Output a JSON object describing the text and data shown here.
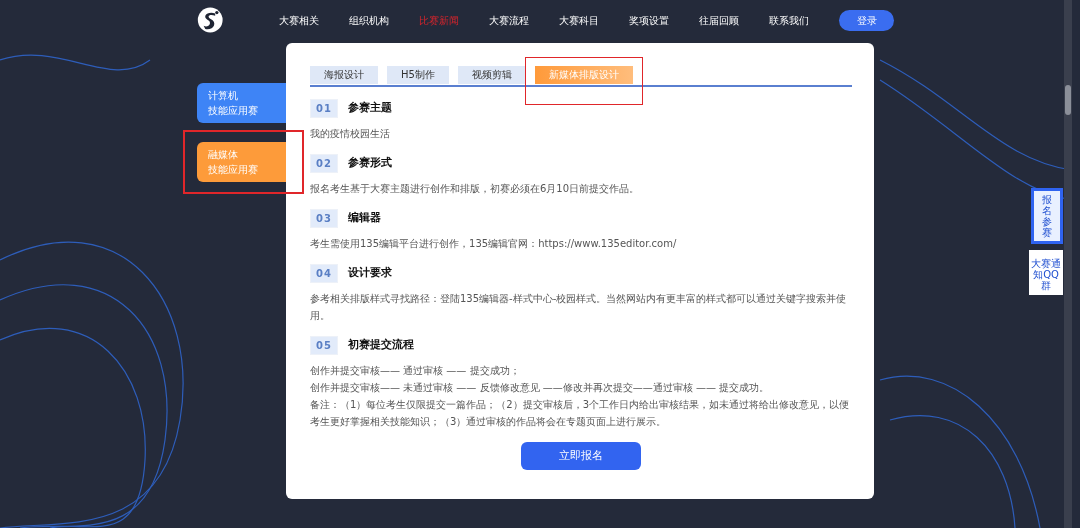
{
  "nav": {
    "items": [
      {
        "label": "大赛相关",
        "selected": false
      },
      {
        "label": "组织机构",
        "selected": false
      },
      {
        "label": "比赛新闻",
        "selected": true
      },
      {
        "label": "大赛流程",
        "selected": false
      },
      {
        "label": "大赛科目",
        "selected": false
      },
      {
        "label": "奖项设置",
        "selected": false
      },
      {
        "label": "往届回顾",
        "selected": false
      },
      {
        "label": "联系我们",
        "selected": false
      }
    ],
    "login": "登录"
  },
  "side_tabs": [
    {
      "lines": [
        "计算机",
        "技能应用赛"
      ],
      "selected": false,
      "highlighted": false
    },
    {
      "lines": [
        "融媒体",
        "技能应用赛"
      ],
      "selected": true,
      "highlighted": true
    }
  ],
  "tabs": [
    {
      "label": "海报设计",
      "selected": false,
      "highlighted": false
    },
    {
      "label": "H5制作",
      "selected": false,
      "highlighted": false
    },
    {
      "label": "视频剪辑",
      "selected": false,
      "highlighted": false
    },
    {
      "label": "新媒体排版设计",
      "selected": true,
      "highlighted": true
    }
  ],
  "sections": [
    {
      "number": "01",
      "title": "参赛主题",
      "paragraphs": [
        "我的疫情校园生活"
      ]
    },
    {
      "number": "02",
      "title": "参赛形式",
      "paragraphs": [
        "报名考生基于大赛主题进行创作和排版，初赛必须在6月10日前提交作品。"
      ]
    },
    {
      "number": "03",
      "title": "编辑器",
      "paragraphs": [
        "考生需使用135编辑平台进行创作，135编辑官网：https://www.135editor.com/"
      ]
    },
    {
      "number": "04",
      "title": "设计要求",
      "paragraphs": [
        "参考相关排版样式寻找路径：登陆135编辑器-样式中心-校园样式。当然网站内有更丰富的样式都可以通过关键字搜索并使用。"
      ]
    },
    {
      "number": "05",
      "title": "初赛提交流程",
      "paragraphs": [
        "创作并提交审核—— 通过审核 —— 提交成功；",
        "创作并提交审核—— 未通过审核 —— 反馈修改意见 ——修改并再次提交——通过审核 —— 提交成功。",
        "备注：（1）每位考生仅限提交一篇作品；（2）提交审核后，3个工作日内给出审核结果，如未通过将给出修改意见，以便考生更好掌握相关技能知识；（3）通过审核的作品将会在专题页面上进行展示。"
      ]
    }
  ],
  "signup_button": "立即报名",
  "float_widgets": [
    {
      "label": "报名参赛",
      "kind": "signup"
    },
    {
      "label": "大赛通知QQ群",
      "kind": "qq"
    }
  ]
}
